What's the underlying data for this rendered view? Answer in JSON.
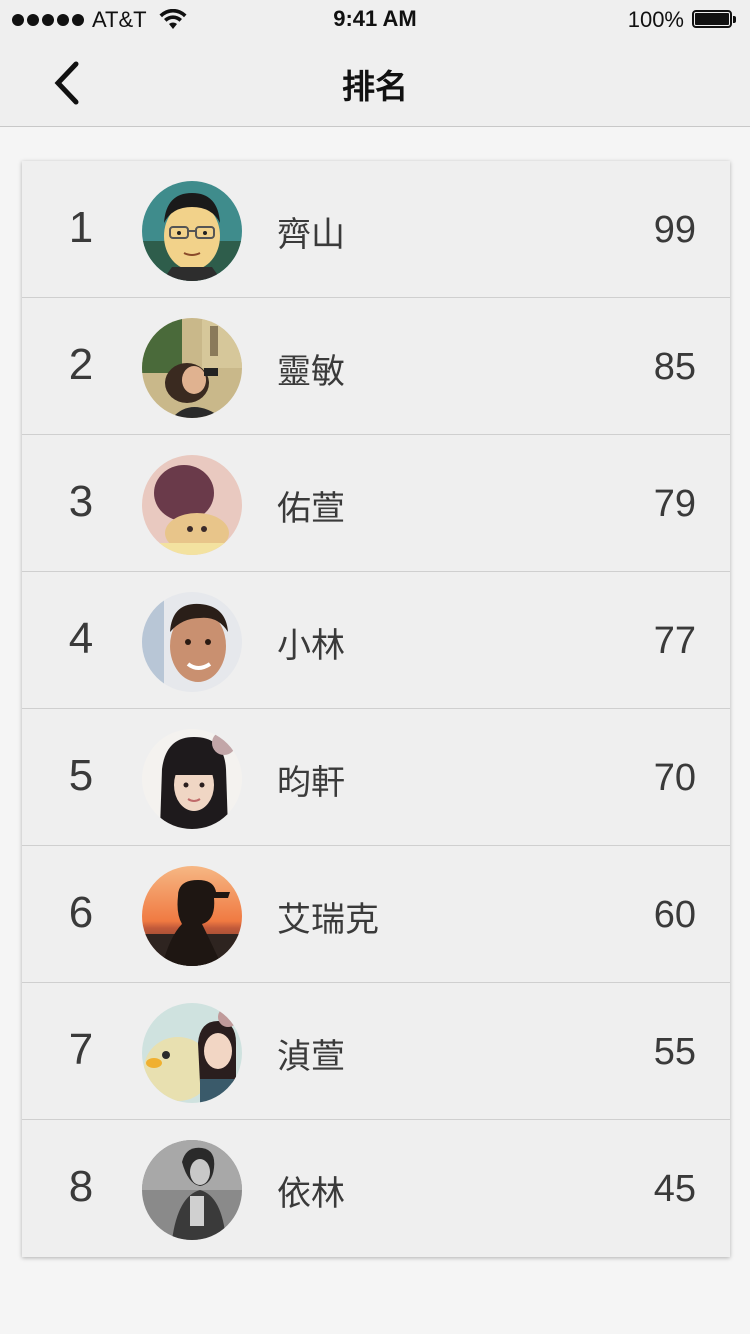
{
  "status_bar": {
    "carrier": "AT&T",
    "time": "9:41 AM",
    "battery": "100%"
  },
  "nav": {
    "title": "排名",
    "back_icon": "chevron-left-icon"
  },
  "ranking": [
    {
      "rank": "1",
      "name": "齊山",
      "score": "99",
      "avatar": "cartoon-man-glasses"
    },
    {
      "rank": "2",
      "name": "靈敏",
      "score": "85",
      "avatar": "woman-photo"
    },
    {
      "rank": "3",
      "name": "佑萱",
      "score": "79",
      "avatar": "girl-with-toy"
    },
    {
      "rank": "4",
      "name": "小林",
      "score": "77",
      "avatar": "smiling-man"
    },
    {
      "rank": "5",
      "name": "昀軒",
      "score": "70",
      "avatar": "girl-bangs"
    },
    {
      "rank": "6",
      "name": "艾瑞克",
      "score": "60",
      "avatar": "sunset-silhouette"
    },
    {
      "rank": "7",
      "name": "湞萱",
      "score": "55",
      "avatar": "girl-with-duck"
    },
    {
      "rank": "8",
      "name": "依林",
      "score": "45",
      "avatar": "bw-woman"
    }
  ]
}
